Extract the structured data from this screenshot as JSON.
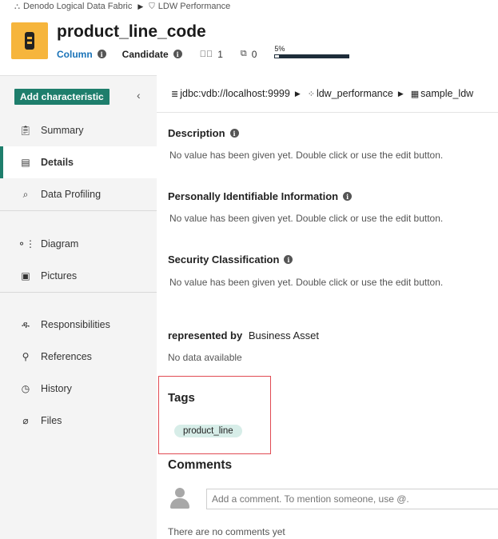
{
  "breadcrumb": {
    "items": [
      "Denodo Logical Data Fabric",
      "LDW Performance"
    ]
  },
  "header": {
    "title": "product_line_code",
    "type_label": "Column",
    "status_label": "Candidate",
    "tag_count": "1",
    "comment_count": "0",
    "completeness_label": "5%",
    "completeness_value": 0.05
  },
  "sidebar": {
    "add_button": "Add characteristic",
    "groups": [
      [
        {
          "label": "Summary",
          "icon": "clipboard-icon"
        },
        {
          "label": "Details",
          "icon": "document-icon",
          "active": true
        },
        {
          "label": "Data Profiling",
          "icon": "profiling-icon"
        }
      ],
      [
        {
          "label": "Diagram",
          "icon": "diagram-icon"
        },
        {
          "label": "Pictures",
          "icon": "picture-icon"
        }
      ],
      [
        {
          "label": "Responsibilities",
          "icon": "people-icon"
        },
        {
          "label": "References",
          "icon": "references-icon"
        },
        {
          "label": "History",
          "icon": "history-icon"
        },
        {
          "label": "Files",
          "icon": "paperclip-icon"
        }
      ]
    ]
  },
  "path": {
    "items": [
      "jdbc:vdb://localhost:9999",
      "ldw_performance",
      "sample_ldw"
    ]
  },
  "attributes": [
    {
      "label": "Description",
      "value": "No value has been given yet. Double click or use the edit button."
    },
    {
      "label": "Personally Identifiable Information",
      "value": "No value has been given yet. Double click or use the edit button."
    },
    {
      "label": "Security Classification",
      "value": "No value has been given yet. Double click or use the edit button."
    }
  ],
  "relation": {
    "label": "represented by",
    "target": "Business Asset",
    "empty_text": "No data available"
  },
  "tags": {
    "title": "Tags",
    "items": [
      "product_line"
    ]
  },
  "comments": {
    "title": "Comments",
    "placeholder": "Add a comment. To mention someone, use @.",
    "empty_text": "There are no comments yet"
  },
  "colors": {
    "primary": "#1e7e6c",
    "asset_icon": "#f6b53c",
    "link": "#1a73b8",
    "highlight": "#e14b53",
    "tag_chip": "#d7ede8"
  }
}
